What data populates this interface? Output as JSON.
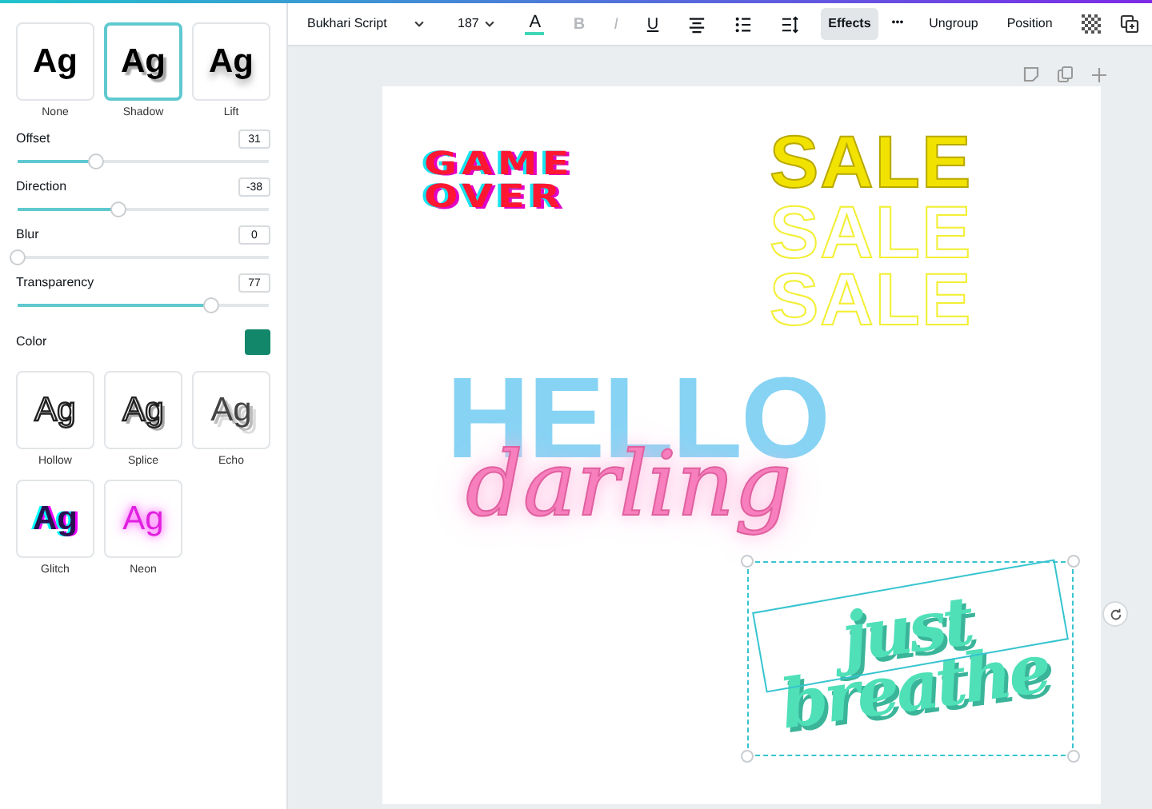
{
  "effect_styles": [
    {
      "label": "None",
      "preview": "Ag",
      "kind": "none",
      "selected": false
    },
    {
      "label": "Shadow",
      "preview": "Ag",
      "kind": "shadow",
      "selected": true
    },
    {
      "label": "Lift",
      "preview": "Ag",
      "kind": "lift",
      "selected": false
    }
  ],
  "settings": [
    {
      "label": "Offset",
      "value": "31",
      "level": 0.31
    },
    {
      "label": "Direction",
      "value": "-38",
      "level": 0.4
    },
    {
      "label": "Blur",
      "value": "0",
      "level": 0
    },
    {
      "label": "Transparency",
      "value": "77",
      "level": 0.77
    }
  ],
  "color_setting": {
    "label": "Color",
    "color": "#12876a"
  },
  "more_styles": [
    {
      "label": "Hollow",
      "preview": "Ag",
      "kind": "hollow",
      "selected": false
    },
    {
      "label": "Splice",
      "preview": "Ag",
      "kind": "splice",
      "selected": false
    },
    {
      "label": "Echo",
      "preview": "Ag",
      "kind": "echo",
      "selected": false
    },
    {
      "label": "Glitch",
      "preview": "Ag",
      "kind": "glitch",
      "selected": false
    },
    {
      "label": "Neon",
      "preview": "Ag",
      "kind": "neon",
      "selected": false
    }
  ],
  "toolbar": {
    "font": "Bukhari Script",
    "size": "187",
    "tools": [
      {
        "kind": "text-color",
        "label": "A",
        "disabled": false,
        "selected": false
      },
      {
        "kind": "bold",
        "label": "B",
        "disabled": true,
        "selected": false
      },
      {
        "kind": "italic",
        "label": "I",
        "disabled": true,
        "selected": false
      },
      {
        "kind": "underline",
        "label": "U",
        "disabled": false,
        "selected": false
      },
      {
        "kind": "align",
        "disabled": false,
        "selected": false
      },
      {
        "kind": "list",
        "disabled": false,
        "selected": false
      },
      {
        "kind": "spacing",
        "disabled": false,
        "selected": false
      },
      {
        "kind": "effects",
        "label": "Effects",
        "disabled": false,
        "selected": true
      },
      {
        "kind": "more",
        "label": "•••",
        "disabled": false,
        "selected": false
      }
    ],
    "right_buttons": [
      "Ungroup",
      "Position"
    ]
  },
  "design_elements": [
    {
      "kind": "glitch",
      "lines": [
        "GAME",
        "OVER"
      ],
      "selected": false
    },
    {
      "kind": "sale-solid",
      "lines": [
        "SALE"
      ],
      "selected": false
    },
    {
      "kind": "sale-outline",
      "lines": [
        "SALE"
      ],
      "selected": false
    },
    {
      "kind": "sale-outline",
      "lines": [
        "SALE"
      ],
      "selected": false
    },
    {
      "kind": "hello",
      "lines": [
        "HELLO"
      ],
      "selected": false
    },
    {
      "kind": "neon",
      "lines": [
        "darling"
      ],
      "selected": false
    },
    {
      "kind": "script",
      "lines": [
        "just",
        "breathe"
      ],
      "selected": true
    }
  ]
}
